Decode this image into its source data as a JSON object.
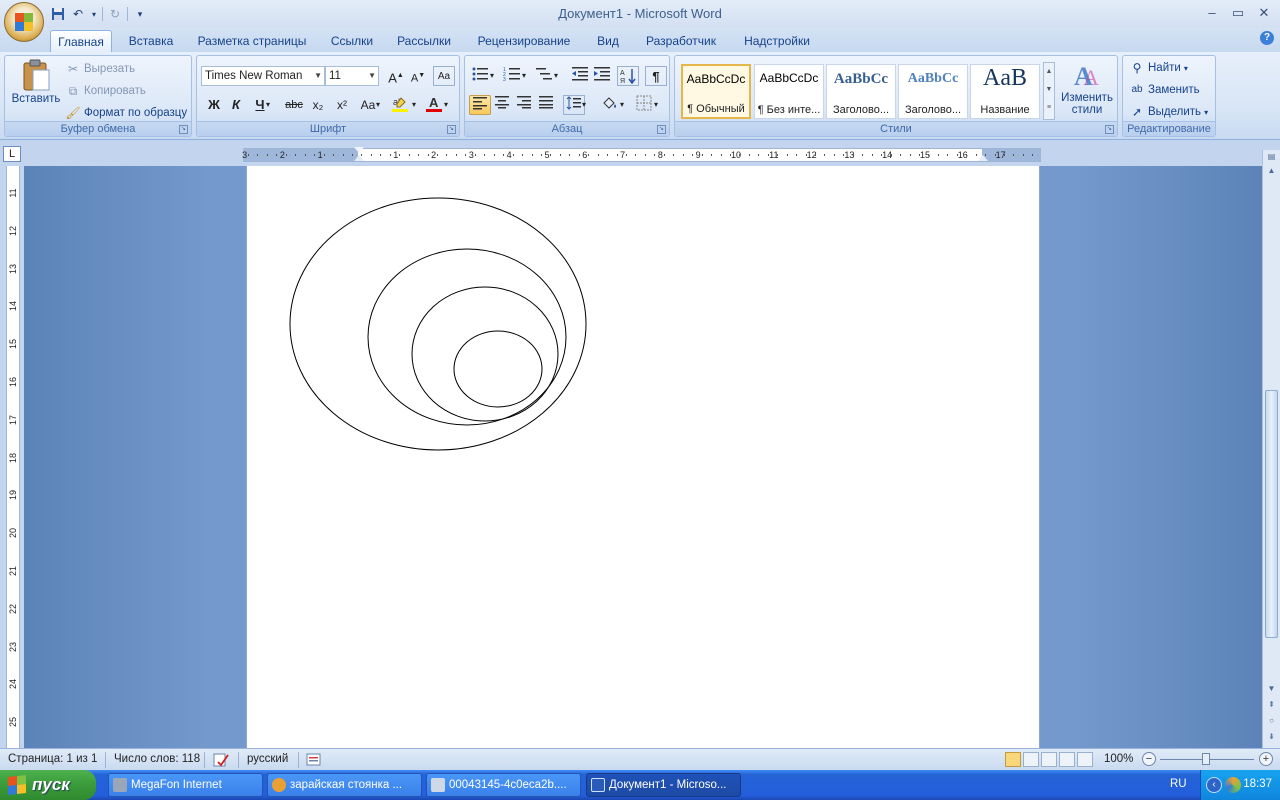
{
  "window": {
    "title": "Документ1 - Microsoft Word",
    "controls": [
      "–",
      "▭",
      "✕"
    ]
  },
  "tabs": [
    {
      "label": "Главная",
      "active": true
    },
    {
      "label": "Вставка"
    },
    {
      "label": "Разметка страницы"
    },
    {
      "label": "Ссылки"
    },
    {
      "label": "Рассылки"
    },
    {
      "label": "Рецензирование"
    },
    {
      "label": "Вид"
    },
    {
      "label": "Разработчик"
    },
    {
      "label": "Надстройки"
    }
  ],
  "ribbon": {
    "clipboard": {
      "label": "Буфер обмена",
      "paste": "Вставить",
      "cut": "Вырезать",
      "copy": "Копировать",
      "format_painter": "Формат по образцу"
    },
    "font": {
      "label": "Шрифт",
      "font_name": "Times New Roman",
      "font_size": "11",
      "bold": "Ж",
      "italic": "К",
      "underline": "Ч",
      "strike": "abc",
      "sub": "x₂",
      "sup": "x²",
      "case": "Aa"
    },
    "paragraph": {
      "label": "Абзац"
    },
    "styles": {
      "label": "Стили",
      "items": [
        {
          "sample": "AaBbCcDc",
          "name": "¶ Обычный",
          "selected": true
        },
        {
          "sample": "AaBbCcDc",
          "name": "¶ Без инте..."
        },
        {
          "sample": "AaBbCc",
          "name": "Заголово..."
        },
        {
          "sample": "AaBbCc",
          "name": "Заголово..."
        },
        {
          "sample": "AaB",
          "name": "Название"
        }
      ],
      "change_styles": "Изменить стили"
    },
    "editing": {
      "label": "Редактирование",
      "find": "Найти",
      "replace": "Заменить",
      "select": "Выделить"
    }
  },
  "ruler": {
    "horizontal_numbers": [
      "3",
      "2",
      "1",
      "1",
      "2",
      "3",
      "4",
      "5",
      "6",
      "7",
      "8",
      "9",
      "10",
      "11",
      "12",
      "13",
      "14",
      "15",
      "16",
      "17"
    ],
    "vertical_numbers": [
      "11",
      "12",
      "13",
      "14",
      "15",
      "16",
      "17",
      "18",
      "19",
      "20",
      "21",
      "22",
      "23",
      "24",
      "25"
    ]
  },
  "statusbar": {
    "page": "Страница: 1 из 1",
    "words": "Число слов: 118",
    "language": "русский",
    "zoom": "100%"
  },
  "taskbar": {
    "start": "пуск",
    "tasks": [
      {
        "label": "MegaFon Internet",
        "color": "#9aa7b8"
      },
      {
        "label": "зарайская стоянка ...",
        "color": "#e9a135"
      },
      {
        "label": "00043145-4c0eca2b....",
        "color": "#cfd8e6"
      },
      {
        "label": "Документ1 - Microso...",
        "color": "#2a5bb8",
        "active": true
      }
    ],
    "lang": "RU",
    "time": "18:37"
  },
  "colors": {
    "accent": "#15428b",
    "doc_bg": "#7499cc",
    "taskbar": "#245edb"
  }
}
